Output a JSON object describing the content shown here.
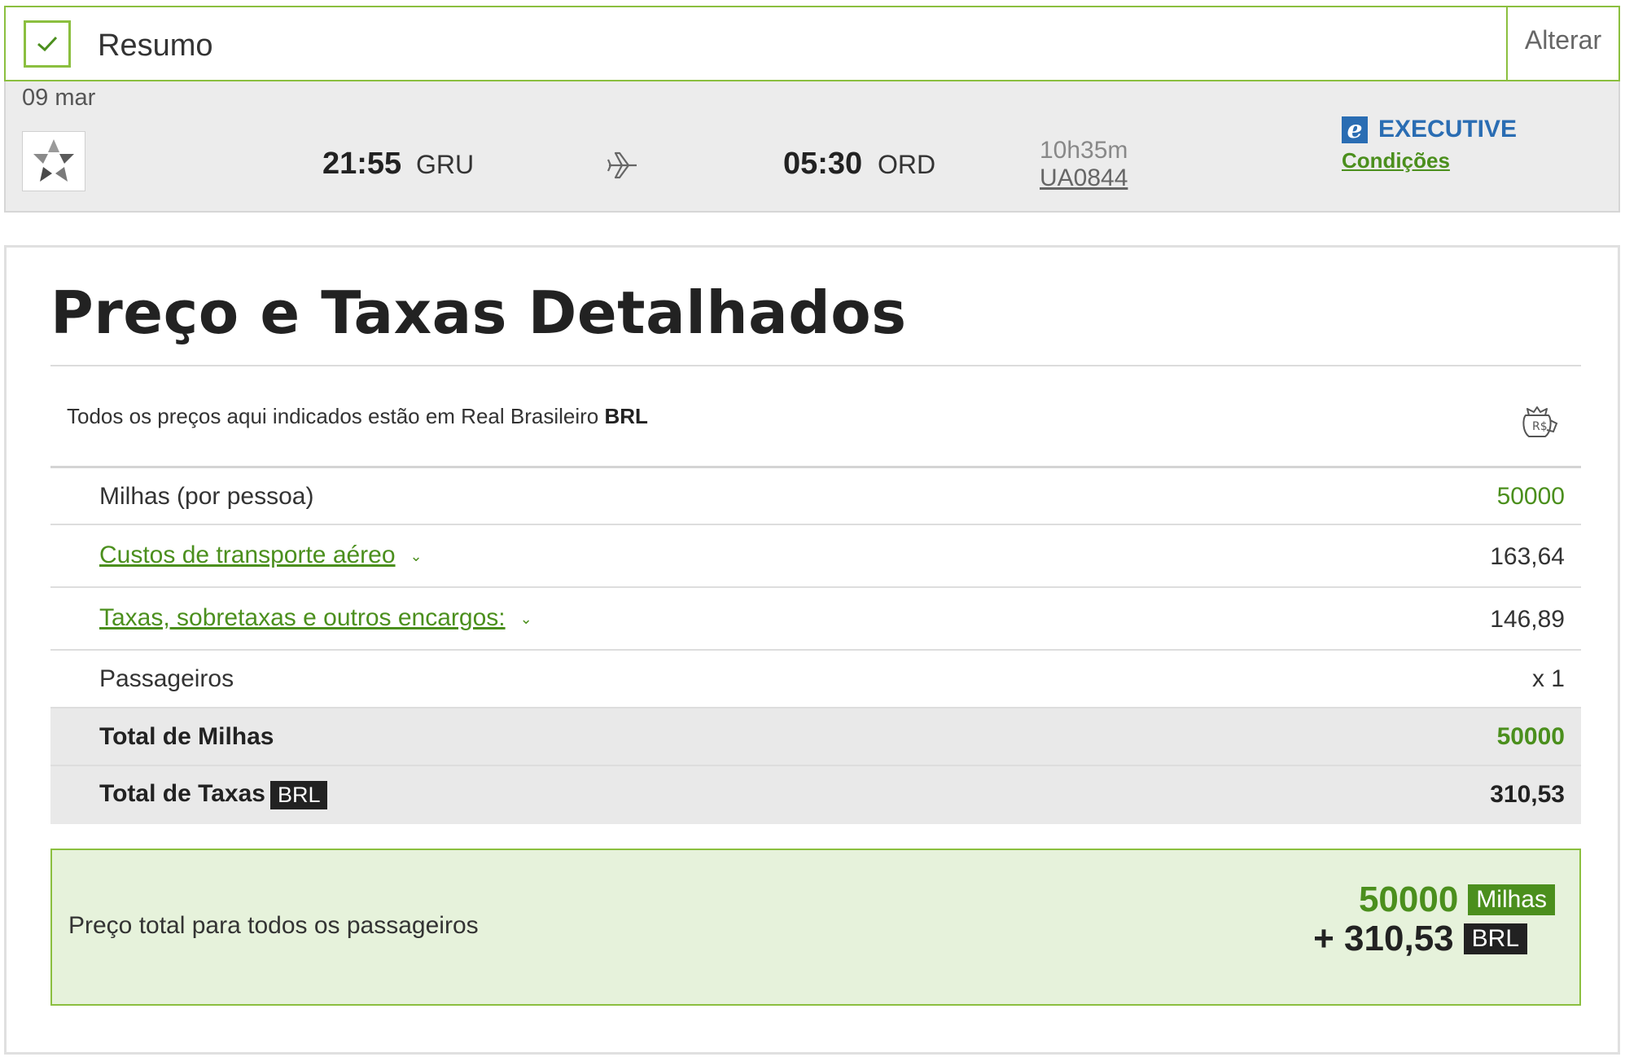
{
  "summary": {
    "title": "Resumo",
    "change_label": "Alterar"
  },
  "flight": {
    "date": "09 mar",
    "airline_logo": "star-alliance-logo",
    "departure_time": "21:55",
    "departure_airport": "GRU",
    "arrival_time": "05:30",
    "arrival_airport": "ORD",
    "duration": "10h35m",
    "flight_number": "UA0844",
    "cabin_icon_letter": "e",
    "cabin": "EXECUTIVE",
    "conditions_link": "Condições"
  },
  "price": {
    "title": "Preço e Taxas Detalhados",
    "currency_note": "Todos os preços aqui indicados estão em Real Brasileiro",
    "currency_code": "BRL",
    "rows": [
      {
        "label": "Milhas (por pessoa)",
        "value": "50000"
      },
      {
        "label": "Custos de transporte aéreo",
        "value": "163,64"
      },
      {
        "label": "Taxas, sobretaxas e outros encargos:",
        "value": "146,89"
      },
      {
        "label": "Passageiros",
        "value": "x 1"
      },
      {
        "label": "Total de Milhas",
        "value": "50000"
      },
      {
        "label": "Total de Taxas",
        "badge": "BRL",
        "value": "310,53"
      }
    ],
    "grand_total": {
      "label": "Preço total para todos os passageiros",
      "miles": "50000",
      "miles_badge": "Milhas",
      "money": "+ 310,53",
      "money_badge": "BRL"
    }
  },
  "colors": {
    "accent_green": "#4b8f1d",
    "border_green": "#8bbf3f",
    "cabin_blue": "#2a6db3"
  }
}
